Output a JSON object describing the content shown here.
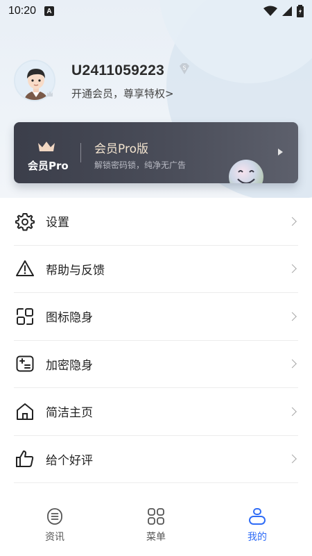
{
  "status_bar": {
    "time": "10:20",
    "notification_letter": "A"
  },
  "profile": {
    "user_id": "U2411059223",
    "badge_letter": "S",
    "subtitle": "开通会员，尊享特权>"
  },
  "pro_card": {
    "logo_text": "会员Pro",
    "title": "会员Pro版",
    "subtitle": "解锁密码锁，纯净无广告"
  },
  "menu": {
    "items": [
      {
        "label": "设置",
        "icon": "gear-icon"
      },
      {
        "label": "帮助与反馈",
        "icon": "warning-icon"
      },
      {
        "label": "图标隐身",
        "icon": "app-hide-icon"
      },
      {
        "label": "加密隐身",
        "icon": "encrypt-icon"
      },
      {
        "label": "简洁主页",
        "icon": "home-icon"
      },
      {
        "label": "给个好评",
        "icon": "thumbs-up-icon"
      }
    ]
  },
  "tabbar": {
    "tabs": [
      {
        "label": "资讯",
        "icon": "news-icon"
      },
      {
        "label": "菜单",
        "icon": "grid-icon"
      },
      {
        "label": "我的",
        "icon": "profile-icon"
      }
    ],
    "active_index": 2,
    "active_color": "#2f6cf6"
  }
}
